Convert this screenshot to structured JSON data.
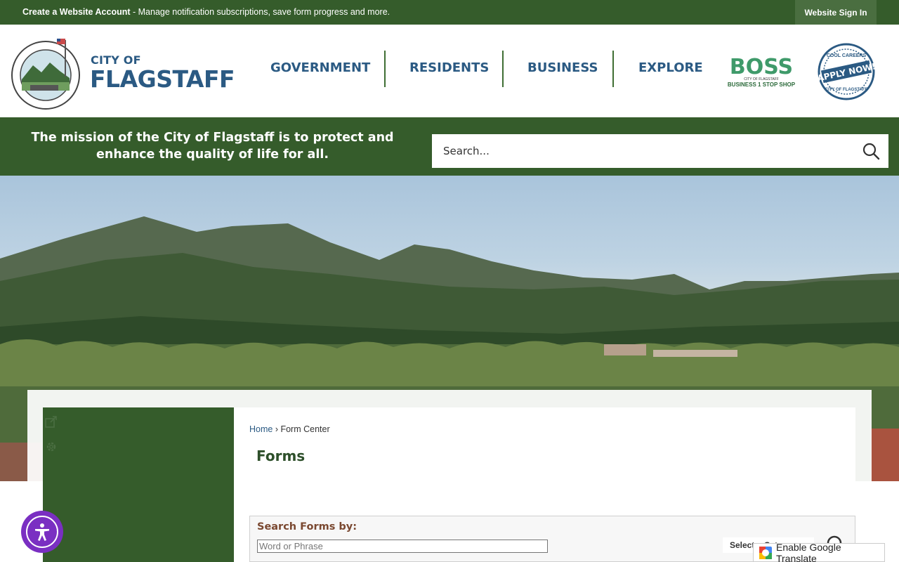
{
  "topbar": {
    "create_account": "Create a Website Account",
    "message": " - Manage notification subscriptions, save form progress and more.",
    "signin": "Website Sign In"
  },
  "header": {
    "brand_small": "CITY OF",
    "brand_big": "FLAGSTAFF",
    "nav": [
      "GOVERNMENT",
      "RESIDENTS",
      "BUSINESS",
      "EXPLORE"
    ],
    "boss_logo": "BOSS",
    "boss_sub1": "CITY OF FLAGSTAFF",
    "boss_sub2": "BUSINESS 1 STOP SHOP",
    "apply_top": "COOL CAREERS",
    "apply_main": "APPLY NOW!",
    "apply_bottom": "CITY OF FLAGSTAFF"
  },
  "band": {
    "mission": "The mission of the City of Flagstaff is to protect and enhance the quality of life for all.",
    "search_placeholder": "Search..."
  },
  "content": {
    "breadcrumb_home": "Home",
    "breadcrumb_sep": " › ",
    "breadcrumb_current": "Form Center",
    "page_title": "Forms",
    "search_forms_label": "Search Forms by:",
    "search_input_placeholder": "Word or Phrase",
    "select_value": "Select a Category"
  },
  "translate": {
    "label": "Enable Google Translate"
  },
  "colors": {
    "green": "#355c2b",
    "blue": "#2b5a83",
    "purple": "#7a2fc2"
  }
}
